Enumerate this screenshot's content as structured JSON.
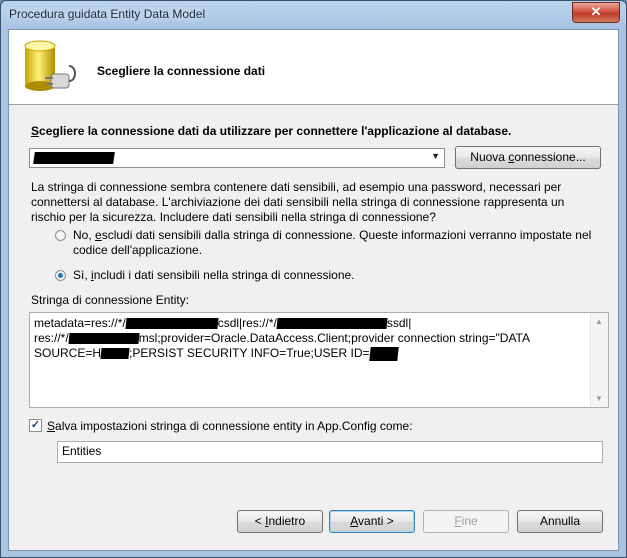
{
  "window": {
    "title": "Procedura guidata Entity Data Model",
    "close_glyph": "✕"
  },
  "header": {
    "icon": "database-connection-icon",
    "title": "Scegliere la connessione dati"
  },
  "connection": {
    "label_prefix": "S",
    "label_rest": "cegliere la connessione dati da utilizzare per connettere l'applicazione al database.",
    "selected_value_redacted": true,
    "dropdown_icon": "▼",
    "new_button_before": "Nuova ",
    "new_button_underline": "c",
    "new_button_after": "onnessione..."
  },
  "warning_text": "La stringa di connessione sembra contenere dati sensibili, ad esempio una password, necessari per connettersi al database. L'archiviazione dei dati sensibili nella stringa di connessione rappresenta un rischio per la sicurezza. Includere dati sensibili nella stringa di connessione?",
  "options": [
    {
      "before": "No, ",
      "underline": "e",
      "after": "scludi dati sensibili dalla stringa di connessione. Queste informazioni verranno impostate nel codice dell'applicazione.",
      "selected": false
    },
    {
      "before": "Sì, ",
      "underline": "i",
      "after": "ncludi i dati sensibili nella stringa di connessione.",
      "selected": true
    }
  ],
  "entity": {
    "label": "Stringa di connessione Entity:",
    "line1_a": "metadata=res://*/",
    "line1_b": "csdl|res://*/",
    "line1_c": "ssdl|",
    "line2_a": "res://*/",
    "line2_b": "msl;provider=Oracle.DataAccess.Client;provider connection string=\"DATA",
    "line3_a": "SOURCE=H",
    "line3_b": ";PERSIST SECURITY INFO=True;USER ID="
  },
  "save_config": {
    "checked": true,
    "check_glyph": "✓",
    "label_underline": "S",
    "label_rest": "alva impostazioni stringa di connessione entity in App.Config come:",
    "value": "Entities"
  },
  "buttons": {
    "back_before": "< ",
    "back_underline": "I",
    "back_after": "ndietro",
    "next_underline": "A",
    "next_after": "vanti >",
    "finish_underline": "F",
    "finish_after": "ine",
    "cancel": "Annulla"
  }
}
